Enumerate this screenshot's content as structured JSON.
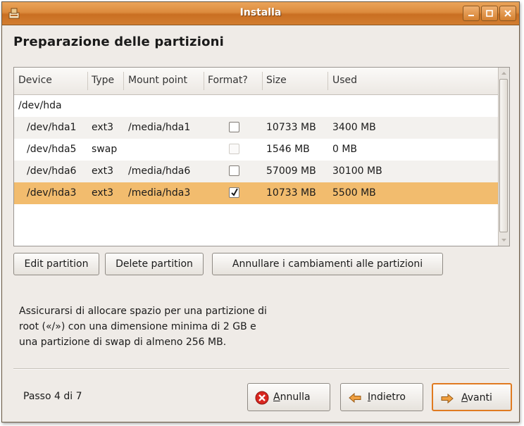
{
  "window": {
    "title": "Installa"
  },
  "page": {
    "heading": "Preparazione delle partizioni"
  },
  "table": {
    "columns": [
      "Device",
      "Type",
      "Mount point",
      "Format?",
      "Size",
      "Used"
    ],
    "rows": [
      {
        "device": "/dev/hda",
        "type": "",
        "mount": "",
        "format": null,
        "size": "",
        "used": "",
        "kind": "disk"
      },
      {
        "device": "/dev/hda1",
        "type": "ext3",
        "mount": "/media/hda1",
        "format": false,
        "size": "10733 MB",
        "used": "3400 MB",
        "kind": "partition"
      },
      {
        "device": "/dev/hda5",
        "type": "swap",
        "mount": "",
        "format": false,
        "format_disabled": true,
        "size": "1546 MB",
        "used": "0 MB",
        "kind": "partition"
      },
      {
        "device": "/dev/hda6",
        "type": "ext3",
        "mount": "/media/hda6",
        "format": false,
        "size": "57009 MB",
        "used": "30100 MB",
        "kind": "partition"
      },
      {
        "device": "/dev/hda3",
        "type": "ext3",
        "mount": "/media/hda3",
        "format": true,
        "size": "10733 MB",
        "used": "5500 MB",
        "kind": "partition",
        "selected": true
      }
    ]
  },
  "partition_buttons": {
    "edit": "Edit partition",
    "delete": "Delete partition",
    "undo": "Annullare i cambiamenti alle partizioni"
  },
  "note": {
    "line1": "Assicurarsi di allocare spazio per una partizione di",
    "line2": "root («/») con una dimensione minima di 2 GB e",
    "line3": "una partizione di swap di almeno 256 MB."
  },
  "footer": {
    "step": "Passo 4 di 7",
    "cancel_prefix": "",
    "cancel_mnemonic": "A",
    "cancel_rest": "nnulla",
    "back_mnemonic": "I",
    "back_rest": "ndietro",
    "next_mnemonic": "A",
    "next_rest": "vanti"
  },
  "colors": {
    "titlebar": "#dc8b3d",
    "selection": "#f2bc6e",
    "default_button_border": "#e07a20"
  },
  "icons": {
    "cancel": "cancel-circle-icon",
    "back": "arrow-left-icon",
    "next": "arrow-right-icon",
    "window": "installer-icon"
  }
}
